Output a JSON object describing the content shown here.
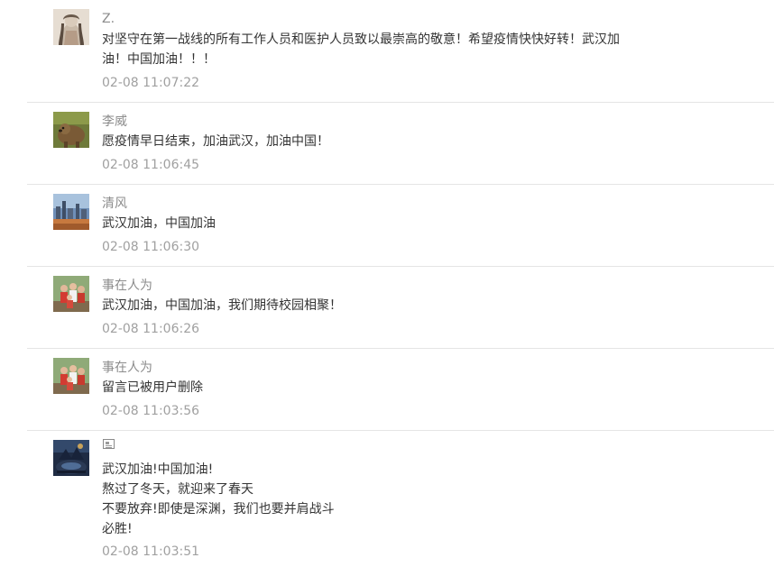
{
  "comments": [
    {
      "nickname": "Z.",
      "avatar": "avatar-sketch-portrait",
      "lines": [
        "对坚守在第一战线的所有工作人员和医护人员致以最崇高的敬意！希望疫情快快好转！武汉加",
        "油！中国加油！！！"
      ],
      "time": "02-08 11:07:22"
    },
    {
      "nickname": "李威",
      "avatar": "avatar-animal-photo",
      "lines": [
        "愿疫情早日结束，加油武汉，加油中国！"
      ],
      "time": "02-08 11:06:45"
    },
    {
      "nickname": "清风",
      "avatar": "avatar-city-landscape",
      "lines": [
        "武汉加油，中国加油"
      ],
      "time": "02-08 11:06:30"
    },
    {
      "nickname": "事在人为",
      "avatar": "avatar-group-photo",
      "lines": [
        "武汉加油，中国加油，我们期待校园相聚！"
      ],
      "time": "02-08 11:06:26"
    },
    {
      "nickname": "事在人为",
      "avatar": "avatar-group-photo",
      "lines": [
        "留言已被用户删除"
      ],
      "time": "02-08 11:03:56"
    },
    {
      "nickname": "",
      "nickname_icon": "card-icon",
      "avatar": "avatar-dark-scene",
      "lines": [
        "武汉加油!中国加油!",
        "熬过了冬天，就迎来了春天",
        "不要放弃!即使是深渊，我们也要并肩战斗",
        "必胜!"
      ],
      "time": "02-08 11:03:51"
    }
  ]
}
